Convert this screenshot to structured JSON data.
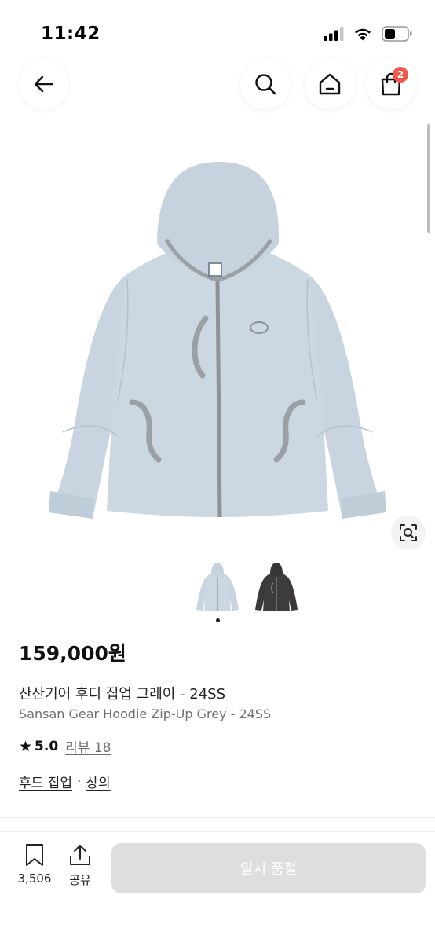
{
  "status_bar": {
    "time": "11:42",
    "icons": [
      "signal-icon",
      "wifi-icon",
      "battery-icon"
    ]
  },
  "nav": {
    "back_icon": "arrow-left-icon",
    "search_icon": "search-icon",
    "home_icon": "home-icon",
    "cart_icon": "shopping-bag-icon",
    "cart_count": "2"
  },
  "product": {
    "image_icon": "hoodie-image",
    "lens_icon": "lens-search-icon",
    "thumbnails": [
      {
        "color": "#c9d6e0",
        "name": "grey"
      },
      {
        "color": "#3a3937",
        "name": "charcoal"
      }
    ],
    "price": "159,000원",
    "name_ko": "산산기어 후디 집업 그레이 - 24SS",
    "name_en": "Sansan Gear Hoodie Zip-Up Grey - 24SS",
    "rating": "5.0",
    "review_label": "리뷰 18",
    "categories": [
      "후드 집업",
      "상의"
    ],
    "category_separator": "·"
  },
  "bottom_bar": {
    "save_count": "3,506",
    "share_label": "공유",
    "buy_button_label": "일시 품절"
  },
  "colors": {
    "badge": "#f0584d",
    "disabled_button": "#dedede",
    "hoodie": "#c8d5e0",
    "hoodie_trim": "#9aa0a6"
  }
}
